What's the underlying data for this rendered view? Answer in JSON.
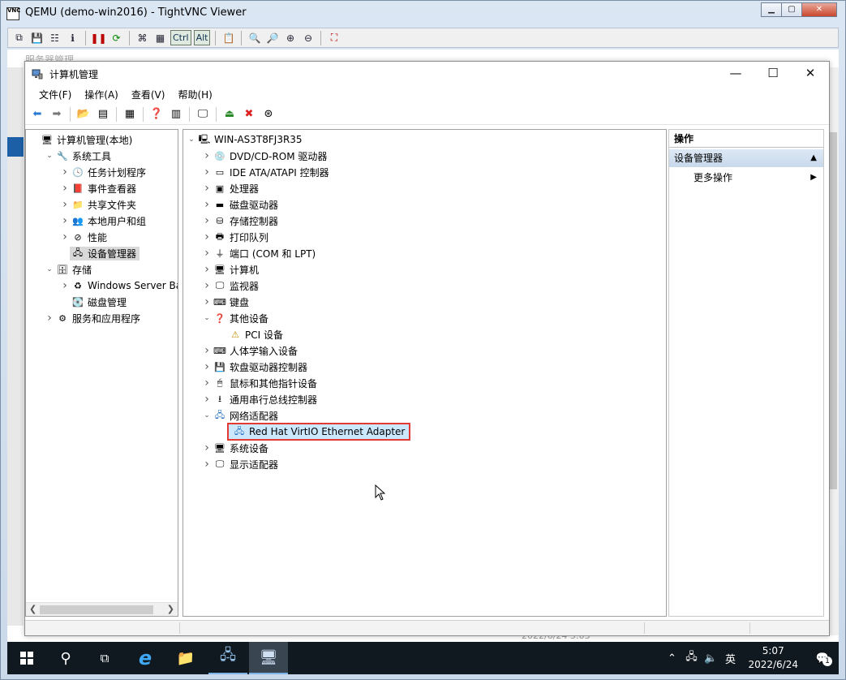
{
  "vnc": {
    "title": "QEMU (demo-win2016) - TightVNC Viewer",
    "app_icon_text": "VNC",
    "toolbar_keys": {
      "ctrl": "Ctrl",
      "alt": "Alt"
    }
  },
  "background_window": {
    "title": "服务器管理",
    "date_text": "2022/6/24 5:03"
  },
  "cm": {
    "title": "计算机管理",
    "menus": [
      "文件(F)",
      "操作(A)",
      "查看(V)",
      "帮助(H)"
    ],
    "left_tree": [
      {
        "label": "计算机管理(本地)",
        "depth": 0,
        "chev": "",
        "icon": "computer-mgmt-icon",
        "glyph": "🖥"
      },
      {
        "label": "系统工具",
        "depth": 1,
        "chev": "v",
        "icon": "system-tools-icon",
        "glyph": "🔧"
      },
      {
        "label": "任务计划程序",
        "depth": 2,
        "chev": ">",
        "icon": "clock-icon",
        "glyph": "🕓"
      },
      {
        "label": "事件查看器",
        "depth": 2,
        "chev": ">",
        "icon": "event-viewer-icon",
        "glyph": "📕"
      },
      {
        "label": "共享文件夹",
        "depth": 2,
        "chev": ">",
        "icon": "shared-folder-icon",
        "glyph": "📁"
      },
      {
        "label": "本地用户和组",
        "depth": 2,
        "chev": ">",
        "icon": "users-icon",
        "glyph": "👥"
      },
      {
        "label": "性能",
        "depth": 2,
        "chev": ">",
        "icon": "performance-icon",
        "glyph": "⊘"
      },
      {
        "label": "设备管理器",
        "depth": 2,
        "chev": "",
        "icon": "device-manager-icon",
        "glyph": "🖧",
        "selected": true
      },
      {
        "label": "存储",
        "depth": 1,
        "chev": "v",
        "icon": "storage-icon",
        "glyph": "🗄"
      },
      {
        "label": "Windows Server Back",
        "depth": 2,
        "chev": ">",
        "icon": "backup-icon",
        "glyph": "♻"
      },
      {
        "label": "磁盘管理",
        "depth": 2,
        "chev": "",
        "icon": "disk-mgmt-icon",
        "glyph": "💽"
      },
      {
        "label": "服务和应用程序",
        "depth": 1,
        "chev": ">",
        "icon": "services-icon",
        "glyph": "⚙"
      }
    ],
    "device_tree": [
      {
        "label": "WIN-AS3T8FJ3R35",
        "depth": 0,
        "chev": "v",
        "icon": "computer-icon",
        "glyph": "🖳"
      },
      {
        "label": "DVD/CD-ROM 驱动器",
        "depth": 1,
        "chev": ">",
        "icon": "dvd-drive-icon",
        "glyph": "💿"
      },
      {
        "label": "IDE ATA/ATAPI 控制器",
        "depth": 1,
        "chev": ">",
        "icon": "ide-controller-icon",
        "glyph": "▭"
      },
      {
        "label": "处理器",
        "depth": 1,
        "chev": ">",
        "icon": "processor-icon",
        "glyph": "▣"
      },
      {
        "label": "磁盘驱动器",
        "depth": 1,
        "chev": ">",
        "icon": "disk-drive-icon",
        "glyph": "▬"
      },
      {
        "label": "存储控制器",
        "depth": 1,
        "chev": ">",
        "icon": "storage-controller-icon",
        "glyph": "⛁"
      },
      {
        "label": "打印队列",
        "depth": 1,
        "chev": ">",
        "icon": "printer-icon",
        "glyph": "🖶"
      },
      {
        "label": "端口 (COM 和 LPT)",
        "depth": 1,
        "chev": ">",
        "icon": "port-icon",
        "glyph": "⏚"
      },
      {
        "label": "计算机",
        "depth": 1,
        "chev": ">",
        "icon": "computer-category-icon",
        "glyph": "🖥"
      },
      {
        "label": "监视器",
        "depth": 1,
        "chev": ">",
        "icon": "monitor-icon",
        "glyph": "🖵"
      },
      {
        "label": "键盘",
        "depth": 1,
        "chev": ">",
        "icon": "keyboard-icon",
        "glyph": "⌨"
      },
      {
        "label": "其他设备",
        "depth": 1,
        "chev": "v",
        "icon": "other-devices-icon",
        "glyph": "❓"
      },
      {
        "label": "PCI 设备",
        "depth": 2,
        "chev": "",
        "icon": "warning-device-icon",
        "glyph": "⚠"
      },
      {
        "label": "人体学输入设备",
        "depth": 1,
        "chev": ">",
        "icon": "hid-icon",
        "glyph": "⌨"
      },
      {
        "label": "软盘驱动器控制器",
        "depth": 1,
        "chev": ">",
        "icon": "floppy-controller-icon",
        "glyph": "💾"
      },
      {
        "label": "鼠标和其他指针设备",
        "depth": 1,
        "chev": ">",
        "icon": "mouse-icon",
        "glyph": "🖱"
      },
      {
        "label": "通用串行总线控制器",
        "depth": 1,
        "chev": ">",
        "icon": "usb-icon",
        "glyph": "⭳"
      },
      {
        "label": "网络适配器",
        "depth": 1,
        "chev": "v",
        "icon": "network-adapter-icon",
        "glyph": "🖧"
      },
      {
        "label": "Red Hat VirtIO Ethernet Adapter",
        "depth": 2,
        "chev": "",
        "icon": "ethernet-adapter-icon",
        "glyph": "🖧",
        "highlighted": true
      },
      {
        "label": "系统设备",
        "depth": 1,
        "chev": ">",
        "icon": "system-devices-icon",
        "glyph": "🖥"
      },
      {
        "label": "显示适配器",
        "depth": 1,
        "chev": ">",
        "icon": "display-adapter-icon",
        "glyph": "🖵"
      }
    ],
    "actions": {
      "header": "操作",
      "group": "设备管理器",
      "more": "更多操作"
    }
  },
  "taskbar": {
    "time": "5:07",
    "date": "2022/6/24",
    "ime": "英",
    "notifications": "1"
  },
  "colors": {
    "highlight_border": "#e53935",
    "selection_bg": "#cce8ff",
    "taskbar_bg": "#101820"
  }
}
